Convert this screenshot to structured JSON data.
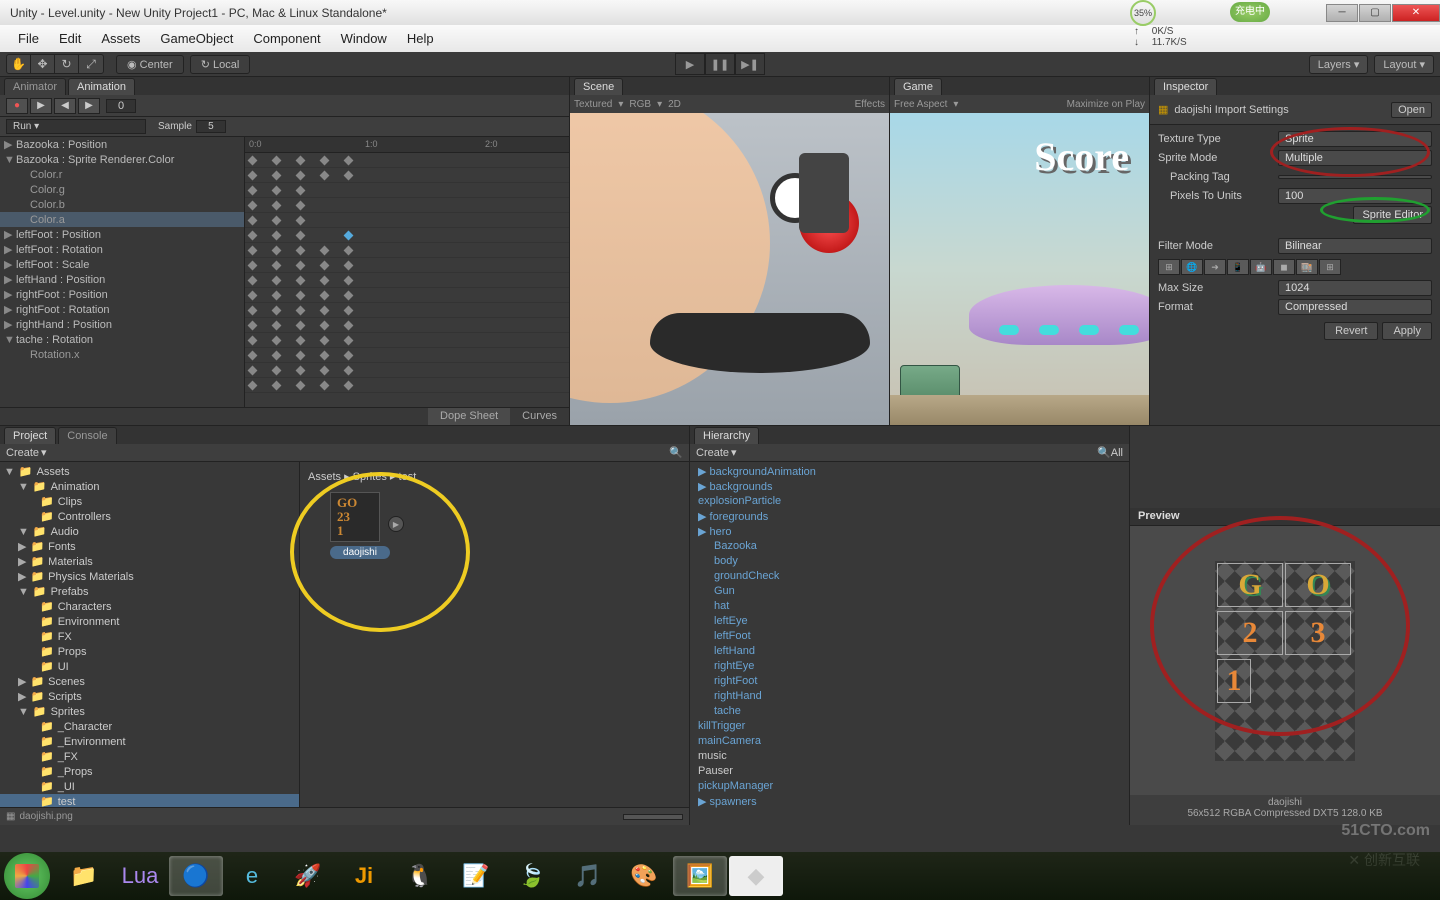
{
  "title": "Unity - Level.unity - New Unity Project1 - PC, Mac & Linux Standalone*",
  "menu": [
    "File",
    "Edit",
    "Assets",
    "GameObject",
    "Component",
    "Window",
    "Help"
  ],
  "net": {
    "pct": "35%",
    "up": "0K/S",
    "down": "11.7K/S"
  },
  "batt": "充电中",
  "toolbar": {
    "center": "Center",
    "local": "Local",
    "layers": "Layers",
    "layout": "Layout"
  },
  "tabs": {
    "animator": "Animator",
    "animation": "Animation",
    "scene": "Scene",
    "game": "Game",
    "inspector": "Inspector",
    "project": "Project",
    "console": "Console",
    "hierarchy": "Hierarchy"
  },
  "anim": {
    "dropdown": "Run",
    "sample_lbl": "Sample",
    "sample_val": "5",
    "frame": "0",
    "ruler": [
      "0:0",
      "1:0",
      "2:0"
    ],
    "props": [
      "Bazooka : Position",
      "Bazooka : Sprite Renderer.Color",
      "Color.r",
      "Color.g",
      "Color.b",
      "Color.a",
      "leftFoot : Position",
      "leftFoot : Rotation",
      "leftFoot : Scale",
      "leftHand : Position",
      "rightFoot : Position",
      "rightFoot : Rotation",
      "rightHand : Position",
      "tache : Rotation",
      "Rotation.x"
    ],
    "dope": "Dope Sheet",
    "curves": "Curves"
  },
  "scene": {
    "opts": [
      "Textured",
      "RGB",
      "2D"
    ],
    "effects": "Effects"
  },
  "game": {
    "aspect": "Free Aspect",
    "max": "Maximize on Play",
    "score": "Score"
  },
  "inspector": {
    "title": "daojishi Import Settings",
    "open": "Open",
    "rows": {
      "tt_lbl": "Texture Type",
      "tt_val": "Sprite",
      "sm_lbl": "Sprite Mode",
      "sm_val": "Multiple",
      "pt_lbl": "Packing Tag",
      "pu_lbl": "Pixels To Units",
      "pu_val": "100",
      "se_btn": "Sprite Editor",
      "fm_lbl": "Filter Mode",
      "fm_val": "Bilinear",
      "ms_lbl": "Max Size",
      "ms_val": "1024",
      "fmt_lbl": "Format",
      "fmt_val": "Compressed"
    },
    "revert": "Revert",
    "apply": "Apply"
  },
  "project": {
    "create": "Create",
    "breadcrumb": "Assets ▸ Sprites ▸ test",
    "asset_name": "daojishi",
    "status": "daojishi.png",
    "tree": [
      [
        "Assets",
        0,
        1
      ],
      [
        "Animation",
        1,
        1
      ],
      [
        "Clips",
        2,
        0
      ],
      [
        "Controllers",
        2,
        0
      ],
      [
        "Audio",
        1,
        1
      ],
      [
        "Fonts",
        1,
        0
      ],
      [
        "Materials",
        1,
        0
      ],
      [
        "Physics Materials",
        1,
        0
      ],
      [
        "Prefabs",
        1,
        1
      ],
      [
        "Characters",
        2,
        0
      ],
      [
        "Environment",
        2,
        0
      ],
      [
        "FX",
        2,
        0
      ],
      [
        "Props",
        2,
        0
      ],
      [
        "UI",
        2,
        0
      ],
      [
        "Scenes",
        1,
        0
      ],
      [
        "Scripts",
        1,
        0
      ],
      [
        "Sprites",
        1,
        1
      ],
      [
        "_Character",
        2,
        0
      ],
      [
        "_Environment",
        2,
        0
      ],
      [
        "_FX",
        2,
        0
      ],
      [
        "_Props",
        2,
        0
      ],
      [
        "_UI",
        2,
        0
      ],
      [
        "test",
        2,
        0,
        1
      ]
    ]
  },
  "hierarchy": {
    "create": "Create",
    "all": "All",
    "items": [
      [
        "backgroundAnimation",
        0,
        1
      ],
      [
        "backgrounds",
        0,
        1
      ],
      [
        "explosionParticle",
        0,
        0
      ],
      [
        "foregrounds",
        0,
        1
      ],
      [
        "hero",
        0,
        1
      ],
      [
        "Bazooka",
        1,
        0
      ],
      [
        "body",
        1,
        0
      ],
      [
        "groundCheck",
        1,
        0
      ],
      [
        "Gun",
        1,
        0
      ],
      [
        "hat",
        1,
        0
      ],
      [
        "leftEye",
        1,
        0
      ],
      [
        "leftFoot",
        1,
        0
      ],
      [
        "leftHand",
        1,
        0
      ],
      [
        "rightEye",
        1,
        0
      ],
      [
        "rightFoot",
        1,
        0
      ],
      [
        "rightHand",
        1,
        0
      ],
      [
        "tache",
        1,
        0
      ],
      [
        "killTrigger",
        0,
        0
      ],
      [
        "mainCamera",
        0,
        0
      ],
      [
        "music",
        0,
        0,
        1
      ],
      [
        "Pauser",
        0,
        0,
        1
      ],
      [
        "pickupManager",
        0,
        0
      ],
      [
        "spawners",
        0,
        1
      ]
    ]
  },
  "preview": {
    "lbl": "Preview",
    "name": "daojishi",
    "info": "56x512  RGBA Compressed DXT5  128.0 KB"
  }
}
